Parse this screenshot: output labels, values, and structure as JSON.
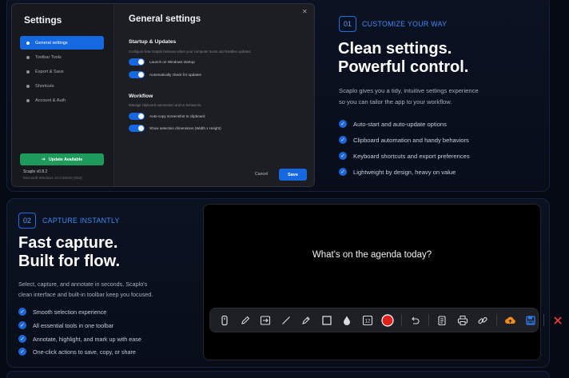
{
  "settings_window": {
    "title": "Settings",
    "nav": [
      {
        "label": "General settings",
        "active": true
      },
      {
        "label": "Toolbar Tools",
        "active": false
      },
      {
        "label": "Export & Save",
        "active": false
      },
      {
        "label": "Shortcuts",
        "active": false
      },
      {
        "label": "Account & Auth",
        "active": false
      }
    ],
    "update_button": "Update Available",
    "version": "Scaplo v0.8.2",
    "system": "Microsoft Windows 10.0.26200 (X64)",
    "main_title": "General settings",
    "groups": [
      {
        "title": "Startup & Updates",
        "description": "Configure how Scaplo behaves when your computer boots and handles updates.",
        "toggles": [
          {
            "label": "Launch on Windows startup",
            "on": true
          },
          {
            "label": "Automatically check for updates",
            "on": true
          }
        ]
      },
      {
        "title": "Workflow",
        "description": "Manage clipboard automation and UI behaviors.",
        "toggles": [
          {
            "label": "Auto-copy screenshot to clipboard",
            "on": true
          },
          {
            "label": "Show selection dimensions (Width x Height)",
            "on": true
          }
        ]
      }
    ],
    "cancel_label": "Cancel",
    "save_label": "Save"
  },
  "section1": {
    "number": "01",
    "kicker": "CUSTOMIZE YOUR WAY",
    "headline_line1": "Clean settings.",
    "headline_line2": "Powerful control.",
    "para_line1": "Scaplo gives you a tidy, intuitive settings experience",
    "para_line2": "so you can tailor the app to your workflow.",
    "features": [
      "Auto-start and auto-update options",
      "Clipboard automation and handy behaviors",
      "Keyboard shortcuts and export preferences",
      "Lightweight by design, heavy on value"
    ]
  },
  "section2": {
    "number": "02",
    "kicker": "CAPTURE INSTANTLY",
    "headline_line1": "Fast capture.",
    "headline_line2": "Built for flow.",
    "para_line1": "Select, capture, and annotate in seconds. Scaplo's",
    "para_line2": "clean interface and built-in toolbar keep you focused.",
    "features": [
      "Smooth selection experience",
      "All essential tools in one toolbar",
      "Annotate, highlight, and mark up with ease",
      "One-click actions to save, copy, or share"
    ]
  },
  "capture": {
    "question": "What's on the agenda today?",
    "tools": [
      "select-tool-icon",
      "pen-tool-icon",
      "arrow-tool-icon",
      "line-tool-icon",
      "marker-tool-icon",
      "rectangle-tool-icon",
      "blur-tool-icon",
      "counter-tool-icon",
      "color-picker-icon",
      "undo-icon",
      "copy-icon",
      "print-icon",
      "link-icon",
      "upload-icon",
      "save-icon",
      "close-icon"
    ]
  },
  "colors": {
    "accent": "#1668e0",
    "success": "#1e9b5a",
    "record_red": "#e0201b",
    "upload_orange": "#f58a1f",
    "close_red": "#e8403a"
  }
}
